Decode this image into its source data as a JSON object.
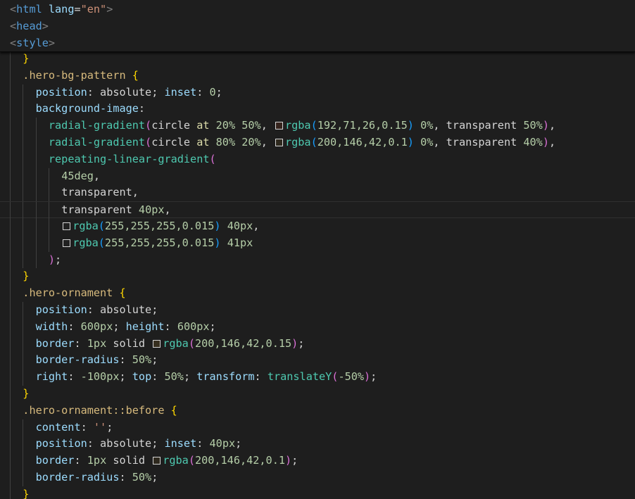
{
  "editor": {
    "language": "css",
    "theme_colors": {
      "background": "#1e1e1e",
      "selector": "#d7ba7d",
      "property": "#9cdcfe",
      "number": "#b5cea8",
      "value": "#ce9178",
      "function": "#dcdcaa",
      "bracket_gold": "#ffd700",
      "bracket_purple": "#da70d6",
      "bracket_blue": "#179fff",
      "tag": "#569cd6"
    },
    "current_line": 9,
    "sticky_lines": [
      [
        {
          "t": "<",
          "c": "t-brk"
        },
        {
          "t": "html",
          "c": "t-tag"
        },
        {
          "t": " ",
          "c": "t-plain"
        },
        {
          "t": "lang",
          "c": "t-attr"
        },
        {
          "t": "=",
          "c": "t-plain"
        },
        {
          "t": "\"en\"",
          "c": "t-str"
        },
        {
          "t": ">",
          "c": "t-brk"
        }
      ],
      [
        {
          "t": "<",
          "c": "t-brk"
        },
        {
          "t": "head",
          "c": "t-tag"
        },
        {
          "t": ">",
          "c": "t-brk"
        }
      ],
      [
        {
          "t": "<",
          "c": "t-brk"
        },
        {
          "t": "style",
          "c": "t-tag"
        },
        {
          "t": ">",
          "c": "t-brk"
        }
      ]
    ],
    "lines": [
      {
        "indent": 1,
        "tokens": [
          {
            "t": "}",
            "c": "t-b1"
          }
        ]
      },
      {
        "indent": 1,
        "tokens": [
          {
            "t": ".hero-bg-pattern",
            "c": "t-sel"
          },
          {
            "t": " ",
            "c": "t-plain"
          },
          {
            "t": "{",
            "c": "t-b1"
          }
        ]
      },
      {
        "indent": 2,
        "tokens": [
          {
            "t": "position",
            "c": "t-prop"
          },
          {
            "t": ": ",
            "c": "t-punc"
          },
          {
            "t": "absolute",
            "c": "t-plain"
          },
          {
            "t": "; ",
            "c": "t-punc"
          },
          {
            "t": "inset",
            "c": "t-prop"
          },
          {
            "t": ": ",
            "c": "t-punc"
          },
          {
            "t": "0",
            "c": "t-num"
          },
          {
            "t": ";",
            "c": "t-punc"
          }
        ]
      },
      {
        "indent": 2,
        "tokens": [
          {
            "t": "background-image",
            "c": "t-prop"
          },
          {
            "t": ":",
            "c": "t-punc"
          }
        ]
      },
      {
        "indent": 3,
        "tokens": [
          {
            "t": "radial-gradient",
            "c": "t-cssfn"
          },
          {
            "t": "(",
            "c": "t-b2"
          },
          {
            "t": "circle ",
            "c": "t-plain"
          },
          {
            "t": "at ",
            "c": "t-fnname"
          },
          {
            "t": "20",
            "c": "t-num"
          },
          {
            "t": "% ",
            "c": "t-num"
          },
          {
            "t": "50",
            "c": "t-num"
          },
          {
            "t": "%",
            "c": "t-num"
          },
          {
            "t": ", ",
            "c": "t-punc"
          },
          {
            "sw": "rgba(192,71,26,0.15)"
          },
          {
            "t": "rgba",
            "c": "t-cssfn"
          },
          {
            "t": "(",
            "c": "t-b3"
          },
          {
            "t": "192,71,26,0.15",
            "c": "t-num"
          },
          {
            "t": ")",
            "c": "t-b3"
          },
          {
            "t": " ",
            "c": "t-plain"
          },
          {
            "t": "0%",
            "c": "t-num"
          },
          {
            "t": ", ",
            "c": "t-punc"
          },
          {
            "t": "transparent ",
            "c": "t-plain"
          },
          {
            "t": "50%",
            "c": "t-num"
          },
          {
            "t": ")",
            "c": "t-b2"
          },
          {
            "t": ",",
            "c": "t-punc"
          }
        ]
      },
      {
        "indent": 3,
        "tokens": [
          {
            "t": "radial-gradient",
            "c": "t-cssfn"
          },
          {
            "t": "(",
            "c": "t-b2"
          },
          {
            "t": "circle ",
            "c": "t-plain"
          },
          {
            "t": "at ",
            "c": "t-fnname"
          },
          {
            "t": "80",
            "c": "t-num"
          },
          {
            "t": "% ",
            "c": "t-num"
          },
          {
            "t": "20",
            "c": "t-num"
          },
          {
            "t": "%",
            "c": "t-num"
          },
          {
            "t": ", ",
            "c": "t-punc"
          },
          {
            "sw": "rgba(200,146,42,0.1)"
          },
          {
            "t": "rgba",
            "c": "t-cssfn"
          },
          {
            "t": "(",
            "c": "t-b3"
          },
          {
            "t": "200,146,42,0.1",
            "c": "t-num"
          },
          {
            "t": ")",
            "c": "t-b3"
          },
          {
            "t": " ",
            "c": "t-plain"
          },
          {
            "t": "0%",
            "c": "t-num"
          },
          {
            "t": ", ",
            "c": "t-punc"
          },
          {
            "t": "transparent ",
            "c": "t-plain"
          },
          {
            "t": "40%",
            "c": "t-num"
          },
          {
            "t": ")",
            "c": "t-b2"
          },
          {
            "t": ",",
            "c": "t-punc"
          }
        ]
      },
      {
        "indent": 3,
        "tokens": [
          {
            "t": "repeating-linear-gradient",
            "c": "t-cssfn"
          },
          {
            "t": "(",
            "c": "t-b2"
          }
        ]
      },
      {
        "indent": 4,
        "tokens": [
          {
            "t": "45",
            "c": "t-num"
          },
          {
            "t": "deg",
            "c": "t-num"
          },
          {
            "t": ",",
            "c": "t-punc"
          }
        ]
      },
      {
        "indent": 4,
        "tokens": [
          {
            "t": "transparent",
            "c": "t-plain"
          },
          {
            "t": ",",
            "c": "t-punc"
          }
        ]
      },
      {
        "indent": 4,
        "tokens": [
          {
            "t": "transparent ",
            "c": "t-plain"
          },
          {
            "t": "40",
            "c": "t-num"
          },
          {
            "t": "px",
            "c": "t-num"
          },
          {
            "t": ",",
            "c": "t-punc"
          }
        ]
      },
      {
        "indent": 4,
        "tokens": [
          {
            "sw": "rgba(255,255,255,0.015)"
          },
          {
            "t": "rgba",
            "c": "t-cssfn"
          },
          {
            "t": "(",
            "c": "t-b3"
          },
          {
            "t": "255,255,255,0.015",
            "c": "t-num"
          },
          {
            "t": ")",
            "c": "t-b3"
          },
          {
            "t": " ",
            "c": "t-plain"
          },
          {
            "t": "40",
            "c": "t-num"
          },
          {
            "t": "px",
            "c": "t-num"
          },
          {
            "t": ",",
            "c": "t-punc"
          }
        ]
      },
      {
        "indent": 4,
        "tokens": [
          {
            "sw": "rgba(255,255,255,0.015)"
          },
          {
            "t": "rgba",
            "c": "t-cssfn"
          },
          {
            "t": "(",
            "c": "t-b3"
          },
          {
            "t": "255,255,255,0.015",
            "c": "t-num"
          },
          {
            "t": ")",
            "c": "t-b3"
          },
          {
            "t": " ",
            "c": "t-plain"
          },
          {
            "t": "41",
            "c": "t-num"
          },
          {
            "t": "px",
            "c": "t-num"
          }
        ]
      },
      {
        "indent": 3,
        "tokens": [
          {
            "t": ")",
            "c": "t-b2"
          },
          {
            "t": ";",
            "c": "t-punc"
          }
        ]
      },
      {
        "indent": 1,
        "tokens": [
          {
            "t": "}",
            "c": "t-b1"
          }
        ]
      },
      {
        "indent": 1,
        "tokens": [
          {
            "t": ".hero-ornament",
            "c": "t-sel"
          },
          {
            "t": " ",
            "c": "t-plain"
          },
          {
            "t": "{",
            "c": "t-b1"
          }
        ]
      },
      {
        "indent": 2,
        "tokens": [
          {
            "t": "position",
            "c": "t-prop"
          },
          {
            "t": ": ",
            "c": "t-punc"
          },
          {
            "t": "absolute",
            "c": "t-plain"
          },
          {
            "t": ";",
            "c": "t-punc"
          }
        ]
      },
      {
        "indent": 2,
        "tokens": [
          {
            "t": "width",
            "c": "t-prop"
          },
          {
            "t": ": ",
            "c": "t-punc"
          },
          {
            "t": "600",
            "c": "t-num"
          },
          {
            "t": "px",
            "c": "t-num"
          },
          {
            "t": "; ",
            "c": "t-punc"
          },
          {
            "t": "height",
            "c": "t-prop"
          },
          {
            "t": ": ",
            "c": "t-punc"
          },
          {
            "t": "600",
            "c": "t-num"
          },
          {
            "t": "px",
            "c": "t-num"
          },
          {
            "t": ";",
            "c": "t-punc"
          }
        ]
      },
      {
        "indent": 2,
        "tokens": [
          {
            "t": "border",
            "c": "t-prop"
          },
          {
            "t": ": ",
            "c": "t-punc"
          },
          {
            "t": "1",
            "c": "t-num"
          },
          {
            "t": "px",
            "c": "t-num"
          },
          {
            "t": " solid ",
            "c": "t-plain"
          },
          {
            "sw": "rgba(200,146,42,0.15)"
          },
          {
            "t": "rgba",
            "c": "t-cssfn"
          },
          {
            "t": "(",
            "c": "t-b2"
          },
          {
            "t": "200,146,42,0.15",
            "c": "t-num"
          },
          {
            "t": ")",
            "c": "t-b2"
          },
          {
            "t": ";",
            "c": "t-punc"
          }
        ]
      },
      {
        "indent": 2,
        "tokens": [
          {
            "t": "border-radius",
            "c": "t-prop"
          },
          {
            "t": ": ",
            "c": "t-punc"
          },
          {
            "t": "50%",
            "c": "t-num"
          },
          {
            "t": ";",
            "c": "t-punc"
          }
        ]
      },
      {
        "indent": 2,
        "tokens": [
          {
            "t": "right",
            "c": "t-prop"
          },
          {
            "t": ": ",
            "c": "t-punc"
          },
          {
            "t": "-100",
            "c": "t-num"
          },
          {
            "t": "px",
            "c": "t-num"
          },
          {
            "t": "; ",
            "c": "t-punc"
          },
          {
            "t": "top",
            "c": "t-prop"
          },
          {
            "t": ": ",
            "c": "t-punc"
          },
          {
            "t": "50%",
            "c": "t-num"
          },
          {
            "t": "; ",
            "c": "t-punc"
          },
          {
            "t": "transform",
            "c": "t-prop"
          },
          {
            "t": ": ",
            "c": "t-punc"
          },
          {
            "t": "translateY",
            "c": "t-cssfn"
          },
          {
            "t": "(",
            "c": "t-b2"
          },
          {
            "t": "-50%",
            "c": "t-num"
          },
          {
            "t": ")",
            "c": "t-b2"
          },
          {
            "t": ";",
            "c": "t-punc"
          }
        ]
      },
      {
        "indent": 1,
        "tokens": [
          {
            "t": "}",
            "c": "t-b1"
          }
        ]
      },
      {
        "indent": 1,
        "tokens": [
          {
            "t": ".hero-ornament::before",
            "c": "t-sel"
          },
          {
            "t": " ",
            "c": "t-plain"
          },
          {
            "t": "{",
            "c": "t-b1"
          }
        ]
      },
      {
        "indent": 2,
        "tokens": [
          {
            "t": "content",
            "c": "t-prop"
          },
          {
            "t": ": ",
            "c": "t-punc"
          },
          {
            "t": "''",
            "c": "t-str"
          },
          {
            "t": ";",
            "c": "t-punc"
          }
        ]
      },
      {
        "indent": 2,
        "tokens": [
          {
            "t": "position",
            "c": "t-prop"
          },
          {
            "t": ": ",
            "c": "t-punc"
          },
          {
            "t": "absolute",
            "c": "t-plain"
          },
          {
            "t": "; ",
            "c": "t-punc"
          },
          {
            "t": "inset",
            "c": "t-prop"
          },
          {
            "t": ": ",
            "c": "t-punc"
          },
          {
            "t": "40",
            "c": "t-num"
          },
          {
            "t": "px",
            "c": "t-num"
          },
          {
            "t": ";",
            "c": "t-punc"
          }
        ]
      },
      {
        "indent": 2,
        "tokens": [
          {
            "t": "border",
            "c": "t-prop"
          },
          {
            "t": ": ",
            "c": "t-punc"
          },
          {
            "t": "1",
            "c": "t-num"
          },
          {
            "t": "px",
            "c": "t-num"
          },
          {
            "t": " solid ",
            "c": "t-plain"
          },
          {
            "sw": "rgba(200,146,42,0.1)"
          },
          {
            "t": "rgba",
            "c": "t-cssfn"
          },
          {
            "t": "(",
            "c": "t-b2"
          },
          {
            "t": "200,146,42,0.1",
            "c": "t-num"
          },
          {
            "t": ")",
            "c": "t-b2"
          },
          {
            "t": ";",
            "c": "t-punc"
          }
        ]
      },
      {
        "indent": 2,
        "tokens": [
          {
            "t": "border-radius",
            "c": "t-prop"
          },
          {
            "t": ": ",
            "c": "t-punc"
          },
          {
            "t": "50%",
            "c": "t-num"
          },
          {
            "t": ";",
            "c": "t-punc"
          }
        ]
      },
      {
        "indent": 1,
        "tokens": [
          {
            "t": "}",
            "c": "t-b1"
          }
        ]
      }
    ]
  }
}
